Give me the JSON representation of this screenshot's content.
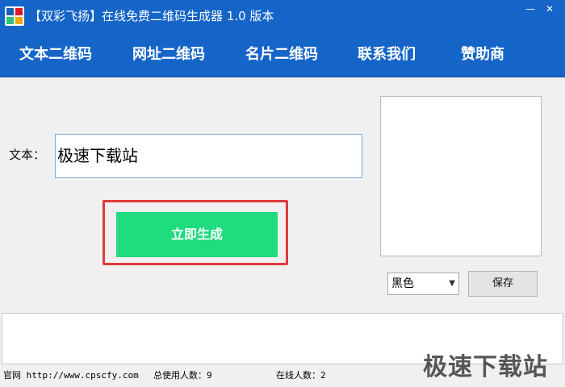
{
  "window": {
    "title": "【双彩飞扬】在线免费二维码生成器 1.0 版本",
    "minimize_symbol": "—",
    "close_symbol": "✕"
  },
  "nav": {
    "items": [
      {
        "label": "文本二维码"
      },
      {
        "label": "网址二维码"
      },
      {
        "label": "名片二维码"
      },
      {
        "label": "联系我们"
      },
      {
        "label": "赞助商"
      }
    ]
  },
  "form": {
    "text_label": "文本：",
    "text_value": "极速下载站",
    "generate_label": "立即生成"
  },
  "options": {
    "color_selected": "黑色",
    "save_label": "保存"
  },
  "status": {
    "website": "官网 http://www.cpscfy.com",
    "total_users": "总使用人数：9",
    "online_users": "在线人数：2"
  },
  "watermark": "极速下载站",
  "colors": {
    "accent_blue": "#1565c8",
    "generate_green": "#1fdc7f",
    "highlight_red": "#e03a3a"
  },
  "icons": {
    "app": "app-grid-icon",
    "select_arrow": "chevron-down-icon"
  }
}
